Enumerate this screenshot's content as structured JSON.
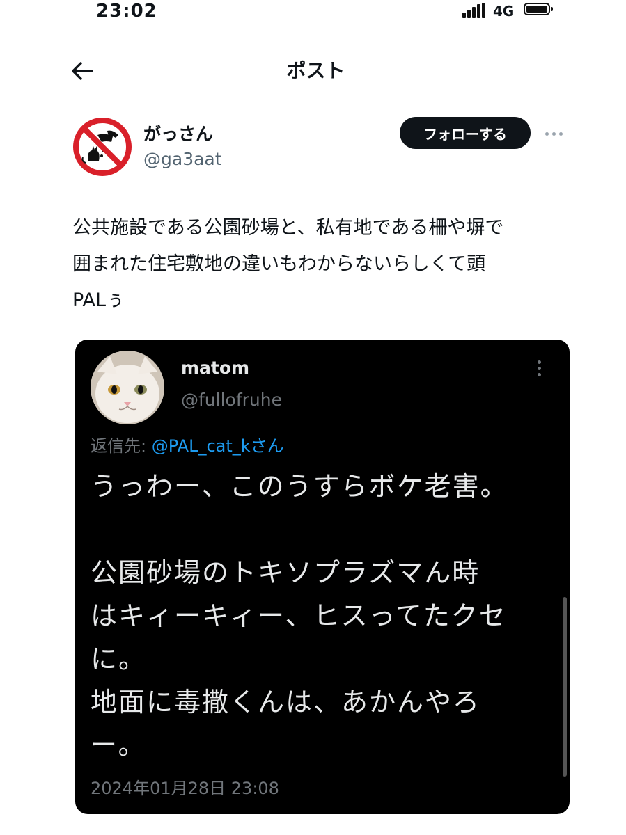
{
  "status_bar": {
    "time": "23:02",
    "network": "4G"
  },
  "header": {
    "title": "ポスト"
  },
  "author": {
    "name": "がっさん",
    "handle": "@ga3aat",
    "follow_label": "フォローする"
  },
  "post": {
    "text": "公共施設である公園砂場と、私有地である柵や塀で\n囲まれた住宅敷地の違いもわからないらしくて頭\nPALぅ"
  },
  "embedded": {
    "name": "matom",
    "handle": "@fullofruhe",
    "reply_prefix": "返信先: ",
    "reply_to": "@PAL_cat_kさん",
    "text": "うっわー、このうすらボケ老害。\n\n公園砂場のトキソプラズマん時\nはキィーキィー、ヒスってたクセ\nに。\n地面に毒撒くんは、あかんやろ\nー。",
    "timestamp": "2024年01月28日 23:08"
  },
  "colors": {
    "accent_link": "#1d9bf0",
    "no_sign_red": "#d9202a"
  }
}
